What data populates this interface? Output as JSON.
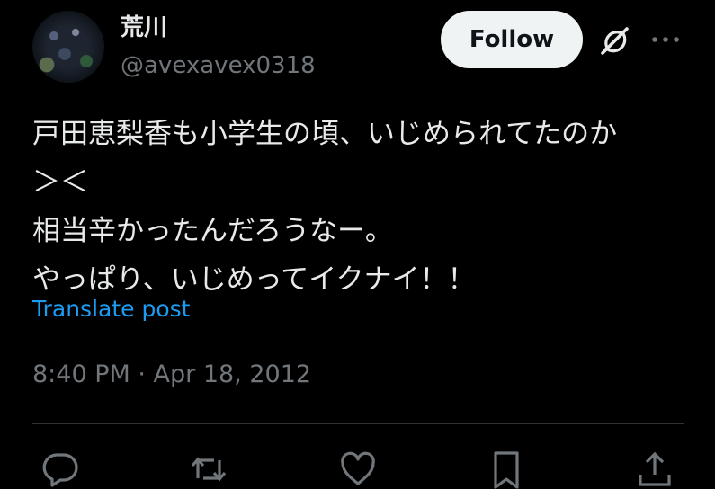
{
  "author": {
    "display_name": "荒川",
    "handle": "@avexavex0318"
  },
  "header": {
    "follow_label": "Follow",
    "grok_icon": "grok-icon",
    "more_icon": "more-icon"
  },
  "tweet": {
    "lines": [
      "戸田恵梨香も小学生の頃、いじめられてたのか",
      "＞＜",
      "相当辛かったんだろうなー。",
      "やっぱり、いじめってイクナイ！！"
    ],
    "translate_label": "Translate post",
    "timestamp": "8:40 PM · Apr 18, 2012"
  },
  "actions": [
    "reply-icon",
    "repost-icon",
    "like-icon",
    "bookmark-icon",
    "share-icon"
  ],
  "colors": {
    "background": "#000000",
    "text": "#e7e9ea",
    "muted": "#71767b",
    "link": "#1d9bf0",
    "button_bg": "#eff3f4"
  }
}
